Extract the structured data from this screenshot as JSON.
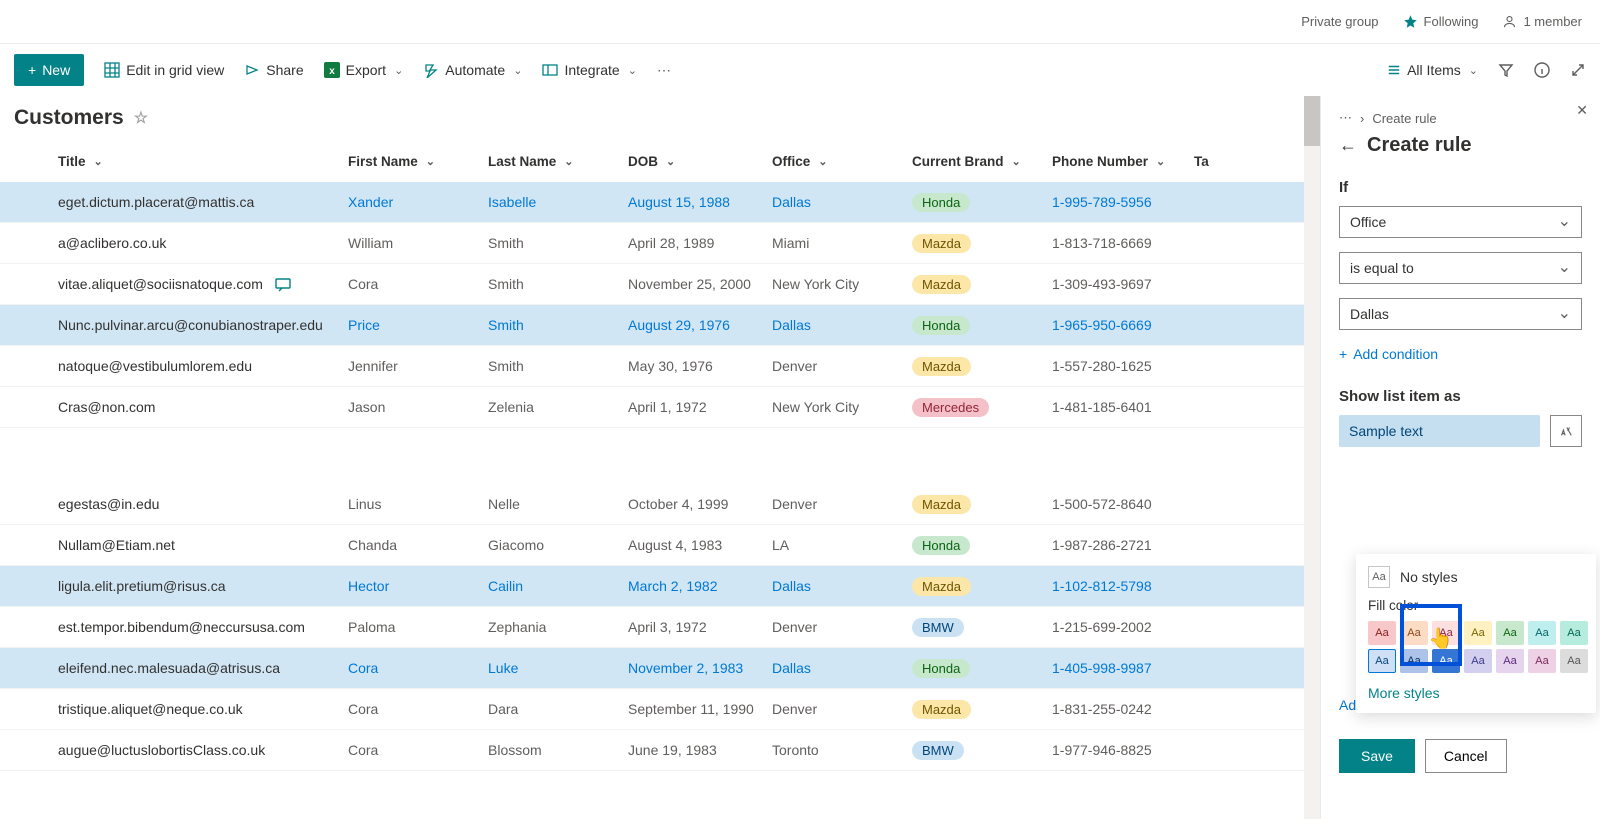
{
  "topbar": {
    "private": "Private group",
    "following": "Following",
    "members": "1 member"
  },
  "toolbar": {
    "new_label": "New",
    "edit_grid": "Edit in grid view",
    "share": "Share",
    "export": "Export",
    "automate": "Automate",
    "integrate": "Integrate",
    "view_name": "All Items"
  },
  "page_title": "Customers",
  "columns": [
    "Title",
    "First Name",
    "Last Name",
    "DOB",
    "Office",
    "Current Brand",
    "Phone Number",
    "Ta"
  ],
  "rows": [
    {
      "hl": true,
      "title": "eget.dictum.placerat@mattis.ca",
      "first": "Xander",
      "last": "Isabelle",
      "dob": "August 15, 1988",
      "office": "Dallas",
      "brand": "Honda",
      "brand_style": "green",
      "phone": "1-995-789-5956"
    },
    {
      "title": "a@aclibero.co.uk",
      "first": "William",
      "last": "Smith",
      "dob": "April 28, 1989",
      "office": "Miami",
      "brand": "Mazda",
      "brand_style": "yellow",
      "phone": "1-813-718-6669"
    },
    {
      "title": "vitae.aliquet@sociisnatoque.com",
      "comment": true,
      "first": "Cora",
      "last": "Smith",
      "dob": "November 25, 2000",
      "office": "New York City",
      "brand": "Mazda",
      "brand_style": "yellow",
      "phone": "1-309-493-9697"
    },
    {
      "hl": true,
      "title": "Nunc.pulvinar.arcu@conubianostraper.edu",
      "first": "Price",
      "last": "Smith",
      "dob": "August 29, 1976",
      "office": "Dallas",
      "brand": "Honda",
      "brand_style": "green",
      "phone": "1-965-950-6669"
    },
    {
      "title": "natoque@vestibulumlorem.edu",
      "first": "Jennifer",
      "last": "Smith",
      "dob": "May 30, 1976",
      "office": "Denver",
      "brand": "Mazda",
      "brand_style": "yellow",
      "phone": "1-557-280-1625"
    },
    {
      "title": "Cras@non.com",
      "first": "Jason",
      "last": "Zelenia",
      "dob": "April 1, 1972",
      "office": "New York City",
      "brand": "Mercedes",
      "brand_style": "pink",
      "phone": "1-481-185-6401"
    },
    {
      "gap": true
    },
    {
      "title": "egestas@in.edu",
      "first": "Linus",
      "last": "Nelle",
      "dob": "October 4, 1999",
      "office": "Denver",
      "brand": "Mazda",
      "brand_style": "yellow",
      "phone": "1-500-572-8640"
    },
    {
      "title": "Nullam@Etiam.net",
      "first": "Chanda",
      "last": "Giacomo",
      "dob": "August 4, 1983",
      "office": "LA",
      "brand": "Honda",
      "brand_style": "green",
      "phone": "1-987-286-2721"
    },
    {
      "hl": true,
      "title": "ligula.elit.pretium@risus.ca",
      "first": "Hector",
      "last": "Cailin",
      "dob": "March 2, 1982",
      "office": "Dallas",
      "brand": "Mazda",
      "brand_style": "yellow",
      "phone": "1-102-812-5798"
    },
    {
      "title": "est.tempor.bibendum@neccursusa.com",
      "first": "Paloma",
      "last": "Zephania",
      "dob": "April 3, 1972",
      "office": "Denver",
      "brand": "BMW",
      "brand_style": "blue",
      "phone": "1-215-699-2002"
    },
    {
      "hl": true,
      "title": "eleifend.nec.malesuada@atrisus.ca",
      "first": "Cora",
      "last": "Luke",
      "dob": "November 2, 1983",
      "office": "Dallas",
      "brand": "Honda",
      "brand_style": "green",
      "phone": "1-405-998-9987"
    },
    {
      "title": "tristique.aliquet@neque.co.uk",
      "first": "Cora",
      "last": "Dara",
      "dob": "September 11, 1990",
      "office": "Denver",
      "brand": "Mazda",
      "brand_style": "yellow",
      "phone": "1-831-255-0242"
    },
    {
      "title": "augue@luctuslobortisClass.co.uk",
      "first": "Cora",
      "last": "Blossom",
      "dob": "June 19, 1983",
      "office": "Toronto",
      "brand": "BMW",
      "brand_style": "blue",
      "phone": "1-977-946-8825"
    }
  ],
  "panel": {
    "breadcrumb_ellipsis": "⋯",
    "breadcrumb": "Create rule",
    "title": "Create rule",
    "if_label": "If",
    "field": "Office",
    "operator": "is equal to",
    "value": "Dallas",
    "add_condition": "Add condition",
    "show_as": "Show list item as",
    "sample": "Sample text",
    "style_pop": {
      "no_styles": "No styles",
      "fill_label": "Fill color",
      "more_styles": "More styles",
      "swatches_row1": [
        {
          "bg": "#f8c7c9",
          "fg": "#8a1c1c"
        },
        {
          "bg": "#fddcc5",
          "fg": "#8a4a1c"
        },
        {
          "bg": "#fbe0df",
          "fg": "#8a1c4a"
        },
        {
          "bg": "#fff1c1",
          "fg": "#7a6400"
        },
        {
          "bg": "#c7e8cc",
          "fg": "#0b6413"
        },
        {
          "bg": "#bfeeee",
          "fg": "#006666"
        },
        {
          "bg": "#b6ecde",
          "fg": "#006655"
        }
      ],
      "swatches_row2": [
        {
          "bg": "#cfe0f6",
          "fg": "#004578",
          "sel": true
        },
        {
          "bg": "#adc2e8",
          "fg": "#003366"
        },
        {
          "bg": "#3576d4",
          "fg": "#ffffff"
        },
        {
          "bg": "#d2d0ee",
          "fg": "#3b3a8a"
        },
        {
          "bg": "#e6d4ee",
          "fg": "#5a2a7a"
        },
        {
          "bg": "#eed1e5",
          "fg": "#7a2a5a"
        },
        {
          "bg": "#dcdcdc",
          "fg": "#555555"
        }
      ]
    },
    "advanced": "Advanced mode",
    "save": "Save",
    "cancel": "Cancel"
  }
}
